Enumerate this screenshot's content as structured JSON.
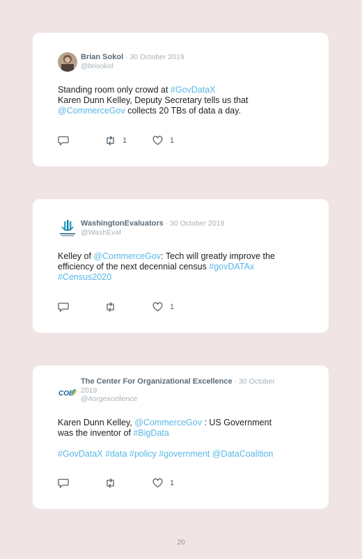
{
  "tweets": [
    {
      "name": "Brian Sokol",
      "date": "· 30 October 2019",
      "handle": "@brisokol",
      "line1": [
        "Standing room only crowd at ",
        "#GovDataX"
      ],
      "line2": "Karen Dunn Kelley, Deputy Secretary tells us that",
      "line3": [
        "@CommerceGov",
        " collects 20 TBs of data a day."
      ],
      "retweets": "1",
      "likes": "1"
    },
    {
      "name": "WashingtonEvaluators",
      "date": "· 30 October 2019",
      "handle": "@WashEval",
      "line1": [
        "Kelley of ",
        "@CommerceGov",
        ": Tech will greatly improve the"
      ],
      "line2": [
        "efficiency of the next decennial census ",
        "#govDATAx"
      ],
      "line3": "#Census2020",
      "likes": "1"
    },
    {
      "name": "The Center For Organizational Excellence",
      "date": "· 30 October",
      "date2": "2019",
      "handle": "@4orgexcellence",
      "logo_text": "COE",
      "line1": [
        "Karen Dunn Kelley, ",
        "@CommerceGov",
        " : US Government"
      ],
      "line2": [
        "was the inventor of ",
        "#BigData"
      ],
      "tags": [
        "#GovDataX",
        "#data",
        "#policy",
        "#government",
        "@DataCoalition"
      ],
      "likes": "1"
    }
  ],
  "page_number": "20",
  "colors": {
    "link": "#57b7e6",
    "background": "#f0e4e4",
    "card": "#ffffff"
  },
  "icons": [
    "reply-icon",
    "retweet-icon",
    "like-icon"
  ]
}
